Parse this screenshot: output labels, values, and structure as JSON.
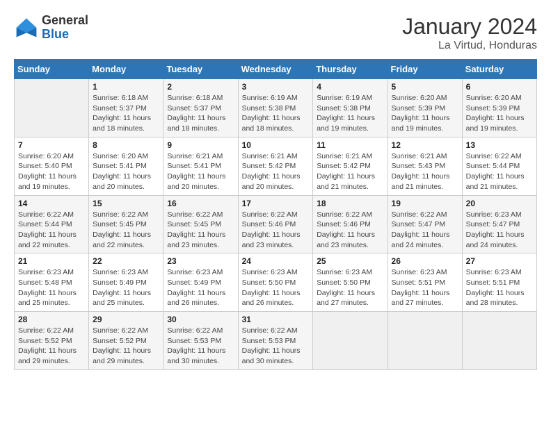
{
  "logo": {
    "general": "General",
    "blue": "Blue"
  },
  "title": "January 2024",
  "subtitle": "La Virtud, Honduras",
  "days_of_week": [
    "Sunday",
    "Monday",
    "Tuesday",
    "Wednesday",
    "Thursday",
    "Friday",
    "Saturday"
  ],
  "weeks": [
    [
      {
        "day": "",
        "sunrise": "",
        "sunset": "",
        "daylight": ""
      },
      {
        "day": "1",
        "sunrise": "Sunrise: 6:18 AM",
        "sunset": "Sunset: 5:37 PM",
        "daylight": "Daylight: 11 hours and 18 minutes."
      },
      {
        "day": "2",
        "sunrise": "Sunrise: 6:18 AM",
        "sunset": "Sunset: 5:37 PM",
        "daylight": "Daylight: 11 hours and 18 minutes."
      },
      {
        "day": "3",
        "sunrise": "Sunrise: 6:19 AM",
        "sunset": "Sunset: 5:38 PM",
        "daylight": "Daylight: 11 hours and 18 minutes."
      },
      {
        "day": "4",
        "sunrise": "Sunrise: 6:19 AM",
        "sunset": "Sunset: 5:38 PM",
        "daylight": "Daylight: 11 hours and 19 minutes."
      },
      {
        "day": "5",
        "sunrise": "Sunrise: 6:20 AM",
        "sunset": "Sunset: 5:39 PM",
        "daylight": "Daylight: 11 hours and 19 minutes."
      },
      {
        "day": "6",
        "sunrise": "Sunrise: 6:20 AM",
        "sunset": "Sunset: 5:39 PM",
        "daylight": "Daylight: 11 hours and 19 minutes."
      }
    ],
    [
      {
        "day": "7",
        "sunrise": "Sunrise: 6:20 AM",
        "sunset": "Sunset: 5:40 PM",
        "daylight": "Daylight: 11 hours and 19 minutes."
      },
      {
        "day": "8",
        "sunrise": "Sunrise: 6:20 AM",
        "sunset": "Sunset: 5:41 PM",
        "daylight": "Daylight: 11 hours and 20 minutes."
      },
      {
        "day": "9",
        "sunrise": "Sunrise: 6:21 AM",
        "sunset": "Sunset: 5:41 PM",
        "daylight": "Daylight: 11 hours and 20 minutes."
      },
      {
        "day": "10",
        "sunrise": "Sunrise: 6:21 AM",
        "sunset": "Sunset: 5:42 PM",
        "daylight": "Daylight: 11 hours and 20 minutes."
      },
      {
        "day": "11",
        "sunrise": "Sunrise: 6:21 AM",
        "sunset": "Sunset: 5:42 PM",
        "daylight": "Daylight: 11 hours and 21 minutes."
      },
      {
        "day": "12",
        "sunrise": "Sunrise: 6:21 AM",
        "sunset": "Sunset: 5:43 PM",
        "daylight": "Daylight: 11 hours and 21 minutes."
      },
      {
        "day": "13",
        "sunrise": "Sunrise: 6:22 AM",
        "sunset": "Sunset: 5:44 PM",
        "daylight": "Daylight: 11 hours and 21 minutes."
      }
    ],
    [
      {
        "day": "14",
        "sunrise": "Sunrise: 6:22 AM",
        "sunset": "Sunset: 5:44 PM",
        "daylight": "Daylight: 11 hours and 22 minutes."
      },
      {
        "day": "15",
        "sunrise": "Sunrise: 6:22 AM",
        "sunset": "Sunset: 5:45 PM",
        "daylight": "Daylight: 11 hours and 22 minutes."
      },
      {
        "day": "16",
        "sunrise": "Sunrise: 6:22 AM",
        "sunset": "Sunset: 5:45 PM",
        "daylight": "Daylight: 11 hours and 23 minutes."
      },
      {
        "day": "17",
        "sunrise": "Sunrise: 6:22 AM",
        "sunset": "Sunset: 5:46 PM",
        "daylight": "Daylight: 11 hours and 23 minutes."
      },
      {
        "day": "18",
        "sunrise": "Sunrise: 6:22 AM",
        "sunset": "Sunset: 5:46 PM",
        "daylight": "Daylight: 11 hours and 23 minutes."
      },
      {
        "day": "19",
        "sunrise": "Sunrise: 6:22 AM",
        "sunset": "Sunset: 5:47 PM",
        "daylight": "Daylight: 11 hours and 24 minutes."
      },
      {
        "day": "20",
        "sunrise": "Sunrise: 6:23 AM",
        "sunset": "Sunset: 5:47 PM",
        "daylight": "Daylight: 11 hours and 24 minutes."
      }
    ],
    [
      {
        "day": "21",
        "sunrise": "Sunrise: 6:23 AM",
        "sunset": "Sunset: 5:48 PM",
        "daylight": "Daylight: 11 hours and 25 minutes."
      },
      {
        "day": "22",
        "sunrise": "Sunrise: 6:23 AM",
        "sunset": "Sunset: 5:49 PM",
        "daylight": "Daylight: 11 hours and 25 minutes."
      },
      {
        "day": "23",
        "sunrise": "Sunrise: 6:23 AM",
        "sunset": "Sunset: 5:49 PM",
        "daylight": "Daylight: 11 hours and 26 minutes."
      },
      {
        "day": "24",
        "sunrise": "Sunrise: 6:23 AM",
        "sunset": "Sunset: 5:50 PM",
        "daylight": "Daylight: 11 hours and 26 minutes."
      },
      {
        "day": "25",
        "sunrise": "Sunrise: 6:23 AM",
        "sunset": "Sunset: 5:50 PM",
        "daylight": "Daylight: 11 hours and 27 minutes."
      },
      {
        "day": "26",
        "sunrise": "Sunrise: 6:23 AM",
        "sunset": "Sunset: 5:51 PM",
        "daylight": "Daylight: 11 hours and 27 minutes."
      },
      {
        "day": "27",
        "sunrise": "Sunrise: 6:23 AM",
        "sunset": "Sunset: 5:51 PM",
        "daylight": "Daylight: 11 hours and 28 minutes."
      }
    ],
    [
      {
        "day": "28",
        "sunrise": "Sunrise: 6:22 AM",
        "sunset": "Sunset: 5:52 PM",
        "daylight": "Daylight: 11 hours and 29 minutes."
      },
      {
        "day": "29",
        "sunrise": "Sunrise: 6:22 AM",
        "sunset": "Sunset: 5:52 PM",
        "daylight": "Daylight: 11 hours and 29 minutes."
      },
      {
        "day": "30",
        "sunrise": "Sunrise: 6:22 AM",
        "sunset": "Sunset: 5:53 PM",
        "daylight": "Daylight: 11 hours and 30 minutes."
      },
      {
        "day": "31",
        "sunrise": "Sunrise: 6:22 AM",
        "sunset": "Sunset: 5:53 PM",
        "daylight": "Daylight: 11 hours and 30 minutes."
      },
      {
        "day": "",
        "sunrise": "",
        "sunset": "",
        "daylight": ""
      },
      {
        "day": "",
        "sunrise": "",
        "sunset": "",
        "daylight": ""
      },
      {
        "day": "",
        "sunrise": "",
        "sunset": "",
        "daylight": ""
      }
    ]
  ]
}
